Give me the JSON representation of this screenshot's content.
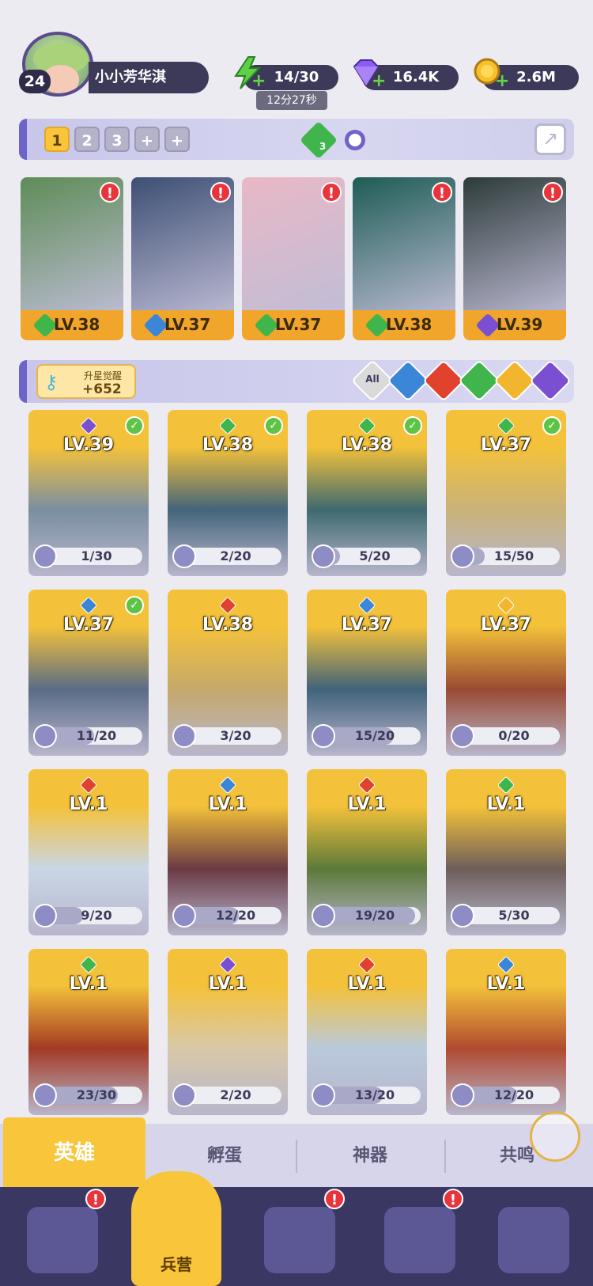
{
  "player": {
    "level": "24",
    "name": "小小芳华淇"
  },
  "resources": {
    "energy": "14/30",
    "energy_timer": "12分27秒",
    "gems": "16.4K",
    "gold": "2.6M"
  },
  "team_tabs": [
    "1",
    "2",
    "3",
    "+",
    "+"
  ],
  "team_gem_count": "3",
  "team_heroes": [
    {
      "level": "LV.38",
      "element": "green"
    },
    {
      "level": "LV.37",
      "element": "blue"
    },
    {
      "level": "LV.37",
      "element": "green"
    },
    {
      "level": "LV.38",
      "element": "green"
    },
    {
      "level": "LV.39",
      "element": "purple"
    }
  ],
  "awaken": {
    "label": "升星觉醒",
    "value": "+652"
  },
  "filters": [
    "All",
    "water",
    "fire",
    "wood",
    "light",
    "dark"
  ],
  "filter_all_label": "All",
  "heroes": [
    {
      "level": "LV.39",
      "element": "purple",
      "shards": "1/30",
      "pct": 0.03,
      "checked": true
    },
    {
      "level": "LV.38",
      "element": "green",
      "shards": "2/20",
      "pct": 0.1,
      "checked": true
    },
    {
      "level": "LV.38",
      "element": "green",
      "shards": "5/20",
      "pct": 0.25,
      "checked": true
    },
    {
      "level": "LV.37",
      "element": "green",
      "shards": "15/50",
      "pct": 0.3,
      "checked": true
    },
    {
      "level": "LV.37",
      "element": "blue",
      "shards": "11/20",
      "pct": 0.55,
      "checked": true
    },
    {
      "level": "LV.38",
      "element": "red",
      "shards": "3/20",
      "pct": 0.15,
      "checked": false
    },
    {
      "level": "LV.37",
      "element": "blue",
      "shards": "15/20",
      "pct": 0.75,
      "checked": false
    },
    {
      "level": "LV.37",
      "element": "yellow",
      "shards": "0/20",
      "pct": 0.0,
      "checked": false
    },
    {
      "level": "LV.1",
      "element": "red",
      "shards": "9/20",
      "pct": 0.45,
      "checked": false
    },
    {
      "level": "LV.1",
      "element": "blue",
      "shards": "12/20",
      "pct": 0.6,
      "checked": false
    },
    {
      "level": "LV.1",
      "element": "red",
      "shards": "19/20",
      "pct": 0.95,
      "checked": false
    },
    {
      "level": "LV.1",
      "element": "green",
      "shards": "5/30",
      "pct": 0.17,
      "checked": false
    },
    {
      "level": "LV.1",
      "element": "green",
      "shards": "23/30",
      "pct": 0.77,
      "checked": false
    },
    {
      "level": "LV.1",
      "element": "purple",
      "shards": "2/20",
      "pct": 0.1,
      "checked": false
    },
    {
      "level": "LV.1",
      "element": "red",
      "shards": "13/20",
      "pct": 0.65,
      "checked": false
    },
    {
      "level": "LV.1",
      "element": "blue",
      "shards": "12/20",
      "pct": 0.6,
      "checked": false
    }
  ],
  "tabs": [
    "英雄",
    "孵蛋",
    "神器",
    "共鸣"
  ],
  "nav": {
    "selected_label": "兵营"
  },
  "colors": {
    "green": "#3FB54C",
    "blue": "#3B86D9",
    "purple": "#7B4FD1",
    "red": "#E0422E",
    "yellow": "#F2B62E",
    "alert": "#E8343A"
  }
}
